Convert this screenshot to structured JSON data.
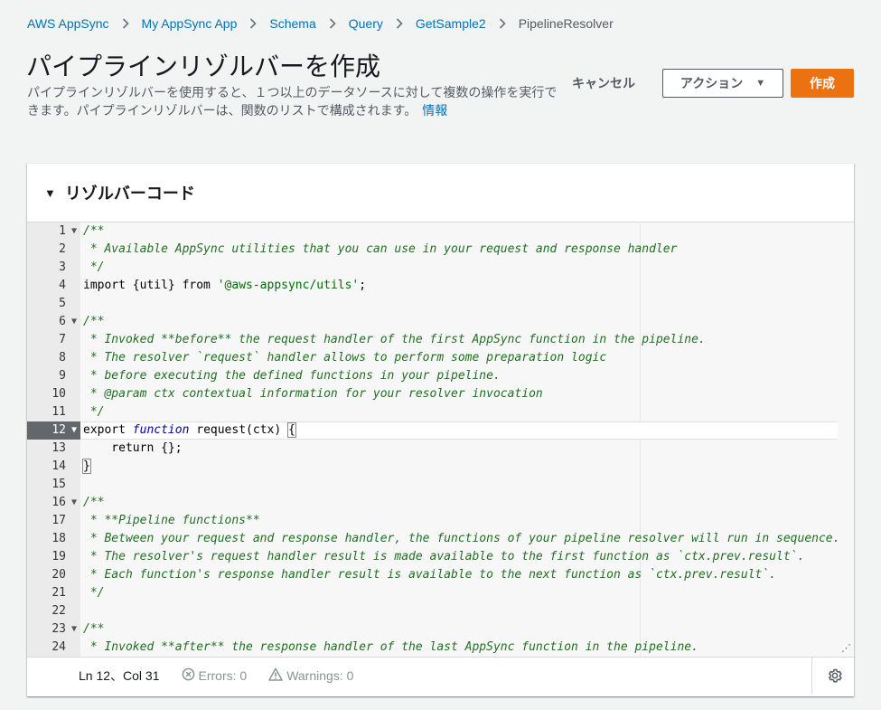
{
  "breadcrumb": {
    "items": [
      "AWS AppSync",
      "My AppSync App",
      "Schema",
      "Query",
      "GetSample2"
    ],
    "current": "PipelineResolver"
  },
  "header": {
    "title": "パイプラインリゾルバーを作成",
    "description": "パイプラインリゾルバーを使用すると、１つ以上のデータソースに対して複数の操作を実行できます。パイプラインリゾルバーは、関数のリストで構成されます。",
    "info_link": "情報",
    "cancel_label": "キャンセル",
    "actions_label": "アクション",
    "create_label": "作成"
  },
  "panel": {
    "title": "リゾルバーコード"
  },
  "editor": {
    "line_numbers": [
      "1",
      "2",
      "3",
      "4",
      "5",
      "6",
      "7",
      "8",
      "9",
      "10",
      "11",
      "12",
      "13",
      "14",
      "15",
      "16",
      "17",
      "18",
      "19",
      "20",
      "21",
      "22",
      "23",
      "24"
    ],
    "fold_lines": [
      "1",
      "6",
      "12",
      "16",
      "23"
    ],
    "active_line": "12"
  },
  "status": {
    "position": "Ln 12、Col 31",
    "errors": "Errors: 0",
    "warnings": "Warnings: 0"
  },
  "icons": {
    "chevron": "chevron-right-icon",
    "caret": "caret-down-icon",
    "collapse": "triangle-down-icon",
    "error": "x-circle-icon",
    "warning": "warning-triangle-icon",
    "settings": "gear-icon"
  },
  "colors": {
    "link": "#0073bb",
    "primary_button": "#ec7211",
    "active_gutter": "#63666b"
  }
}
